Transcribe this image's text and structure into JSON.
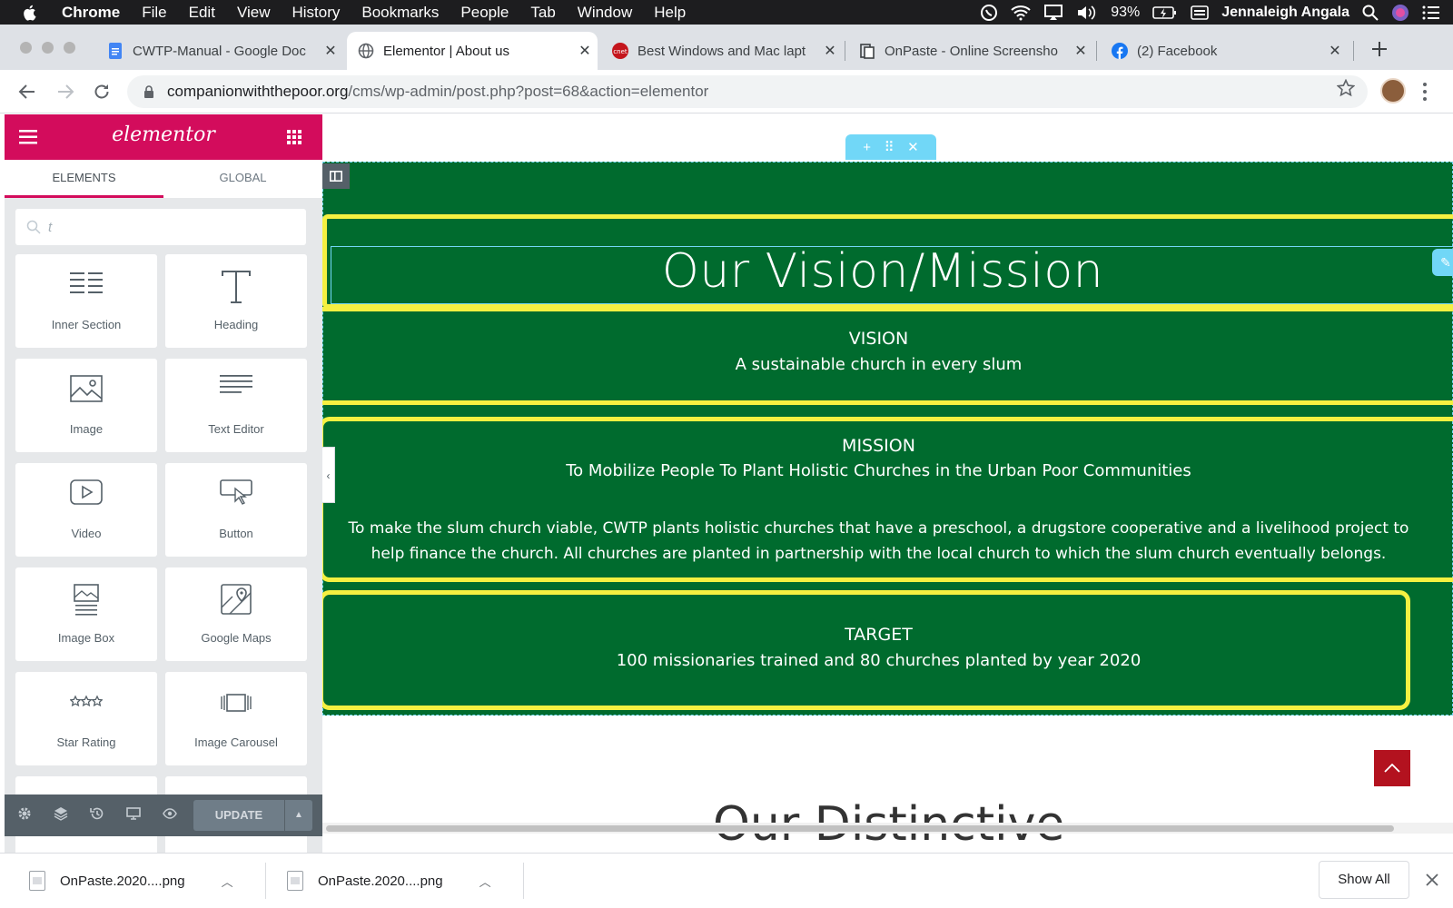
{
  "menubar": {
    "items": [
      "Chrome",
      "File",
      "Edit",
      "View",
      "History",
      "Bookmarks",
      "People",
      "Tab",
      "Window",
      "Help"
    ],
    "battery": "93%",
    "user": "Jennaleigh Angala"
  },
  "tabs": [
    {
      "title": "CWTP-Manual - Google Doc",
      "favicon": "google-docs-icon",
      "active": false
    },
    {
      "title": "Elementor | About us",
      "favicon": "globe-icon",
      "active": true
    },
    {
      "title": "Best Windows and Mac lapt",
      "favicon": "cnet-icon",
      "active": false
    },
    {
      "title": "OnPaste - Online Screensho",
      "favicon": "onpaste-icon",
      "active": false
    },
    {
      "title": "(2) Facebook",
      "favicon": "facebook-icon",
      "active": false
    }
  ],
  "tab_close": "✕",
  "omnibox": {
    "host": "companionwiththepoor.org",
    "path": "/cms/wp-admin/post.php?post=68&action=elementor"
  },
  "elementor": {
    "logo": "elementor",
    "tabs": [
      "ELEMENTS",
      "GLOBAL"
    ],
    "search_value": "t",
    "widgets": [
      {
        "label": "Inner Section",
        "icon": "inner-section-icon"
      },
      {
        "label": "Heading",
        "icon": "heading-icon"
      },
      {
        "label": "Image",
        "icon": "image-icon"
      },
      {
        "label": "Text Editor",
        "icon": "text-editor-icon"
      },
      {
        "label": "Video",
        "icon": "video-icon"
      },
      {
        "label": "Button",
        "icon": "button-icon"
      },
      {
        "label": "Image Box",
        "icon": "image-box-icon"
      },
      {
        "label": "Google Maps",
        "icon": "google-maps-icon"
      },
      {
        "label": "Star Rating",
        "icon": "star-rating-icon"
      },
      {
        "label": "Image Carousel",
        "icon": "image-carousel-icon"
      }
    ],
    "update_label": "UPDATE",
    "accent": "#d30c5c"
  },
  "page": {
    "heading": "Our Vision/Mission",
    "vision": {
      "title": "VISION",
      "text": "A sustainable church in every slum"
    },
    "mission": {
      "title": "MISSION",
      "subtitle": "To Mobilize People To Plant Holistic Churches in the Urban Poor Communities",
      "body": "To make the slum church viable, CWTP plants holistic churches that have a preschool, a drugstore cooperative and a livelihood project to help finance the church. All churches are planted in partnership with the local church to which the slum church eventually belongs."
    },
    "target": {
      "title": "TARGET",
      "text": "100 missionaries trained and 80 churches planted by year 2020"
    },
    "next_heading_partial": "Our Distinctive",
    "section_color": "#006b2e",
    "highlight_color": "#f5f041"
  },
  "downloads": {
    "items": [
      "OnPaste.2020....png",
      "OnPaste.2020....png"
    ],
    "show_all": "Show All"
  }
}
